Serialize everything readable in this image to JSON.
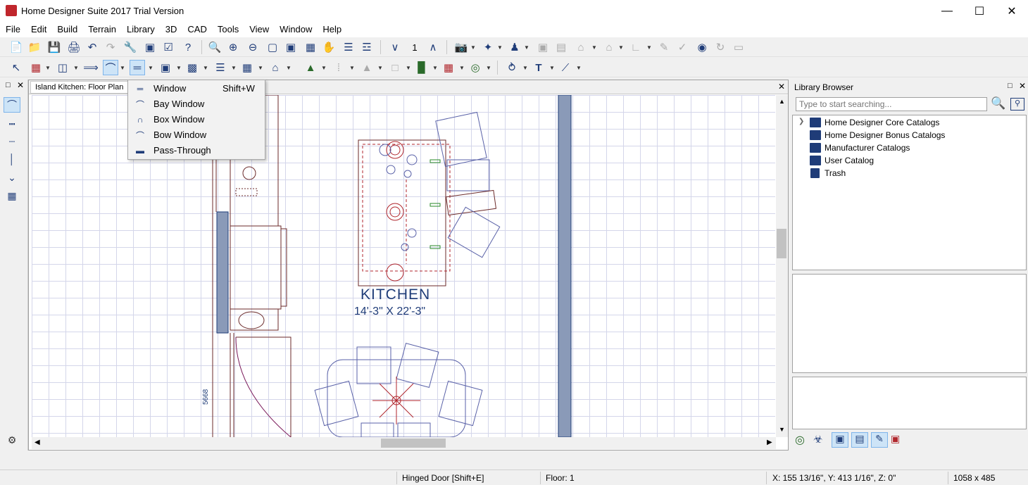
{
  "window": {
    "title": "Home Designer Suite 2017 Trial Version"
  },
  "menu": [
    "File",
    "Edit",
    "Build",
    "Terrain",
    "Library",
    "3D",
    "CAD",
    "Tools",
    "View",
    "Window",
    "Help"
  ],
  "toolbar": {
    "floor_number": "1"
  },
  "canvas": {
    "tab_label": "Island Kitchen: Floor Plan",
    "room_name": "KITCHEN",
    "room_dims": "14'-3\" X 22'-3\"",
    "wall_label": "5668"
  },
  "dropdown": {
    "items": [
      {
        "label": "Window",
        "shortcut": "Shift+W"
      },
      {
        "label": "Bay Window",
        "shortcut": ""
      },
      {
        "label": "Box Window",
        "shortcut": ""
      },
      {
        "label": "Bow Window",
        "shortcut": ""
      },
      {
        "label": "Pass-Through",
        "shortcut": ""
      }
    ]
  },
  "library": {
    "title": "Library Browser",
    "search_placeholder": "Type to start searching...",
    "items": [
      {
        "label": "Home Designer Core Catalogs"
      },
      {
        "label": "Home Designer Bonus Catalogs"
      },
      {
        "label": "Manufacturer Catalogs"
      },
      {
        "label": "User Catalog"
      },
      {
        "label": "Trash"
      }
    ]
  },
  "status": {
    "tool": "Hinged Door [Shift+E]",
    "floor": "Floor: 1",
    "coords": "X: 155 13/16\", Y: 413 1/16\", Z: 0\"",
    "size": "1058 x 485"
  },
  "colors": {
    "accent": "#1f3c78",
    "wall": "#8a9ab8",
    "fixture_red": "#b0262c",
    "furniture": "#5a62a8"
  }
}
